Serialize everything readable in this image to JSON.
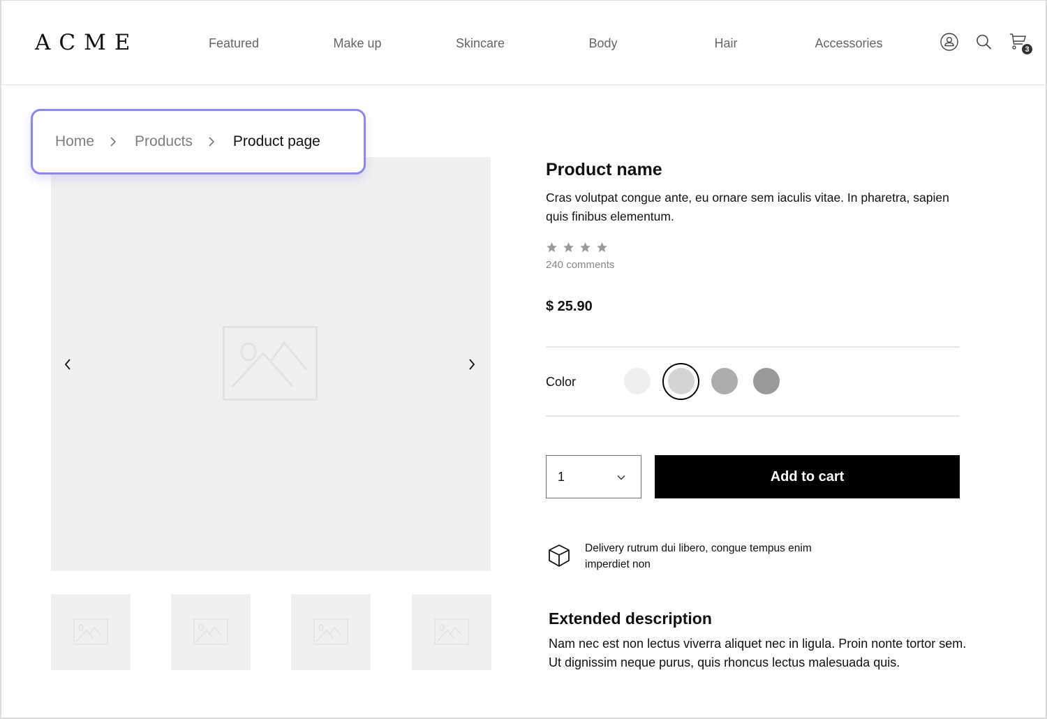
{
  "header": {
    "logo": "ACME",
    "nav": [
      {
        "label": "Featured"
      },
      {
        "label": "Make up"
      },
      {
        "label": "Skincare"
      },
      {
        "label": "Body"
      },
      {
        "label": "Hair"
      },
      {
        "label": "Accessories"
      }
    ],
    "icons": [
      "account-icon",
      "search-icon",
      "cart-icon"
    ],
    "cart_count": "3"
  },
  "breadcrumb": {
    "items": [
      {
        "label": "Home"
      },
      {
        "label": "Products"
      },
      {
        "label": "Product page"
      }
    ],
    "highlight_color": "#8d86f2"
  },
  "gallery": {
    "main_image": "image-placeholder",
    "thumbnails": [
      "image-placeholder",
      "image-placeholder",
      "image-placeholder",
      "image-placeholder"
    ],
    "prev_icon": "chevron-left-icon",
    "next_icon": "chevron-right-icon"
  },
  "product": {
    "name": "Product name",
    "description": "Cras volutpat congue ante, eu ornare sem iaculis vitae. In pharetra, sapien quis finibus elementum.",
    "rating_stars": 4,
    "comments": "240 comments",
    "price": "$ 25.90",
    "color_label": "Color",
    "colors": [
      "#efefef",
      "#d4d4d4",
      "#adadad",
      "#999999"
    ],
    "selected_color_index": 1,
    "quantity": "1",
    "add_to_cart_label": "Add to cart",
    "delivery_text": "Delivery rutrum dui libero, congue tempus enim imperdiet non",
    "extended_title": "Extended description",
    "extended_description": "Nam nec est non lectus viverra aliquet nec in ligula. Proin nonte tortor sem. Ut dignissim neque purus, quis rhoncus lectus malesuada quis."
  }
}
